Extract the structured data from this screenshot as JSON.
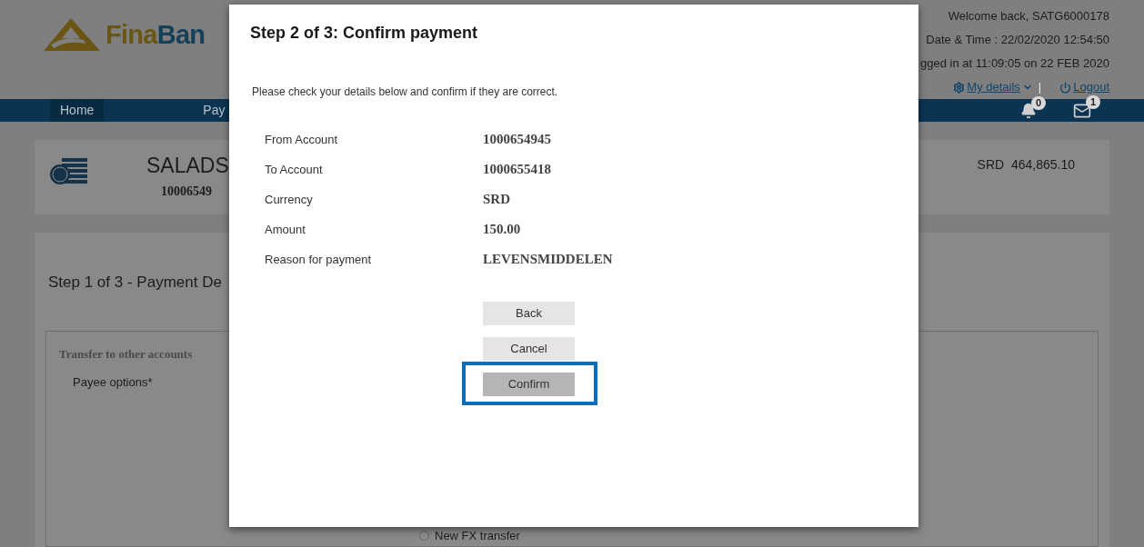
{
  "header": {
    "logo_first": "Fina",
    "logo_second": "Ban",
    "welcome": "Welcome back, SATG6000178",
    "datetime": "Date & Time : 22/02/2020 12:54:50",
    "last_login": "gged in at 11:09:05 on 22 FEB 2020",
    "my_details": "My details",
    "separator": "|",
    "logout": "Logout"
  },
  "nav": {
    "items": [
      {
        "label": "Home",
        "selected": true
      },
      {
        "label": "Pay",
        "selected": false
      }
    ],
    "notifications": "0",
    "messages": "1"
  },
  "account": {
    "name": "SALADS",
    "number": "10006549",
    "balance": "SRD  464,865.10"
  },
  "form": {
    "title": "Step 1 of 3 - Payment De",
    "section": "Transfer to other accounts",
    "payee_label": "Payee options*",
    "radio": {
      "label": "New FX transfer",
      "selected": false
    }
  },
  "modal": {
    "title": "Step 2 of 3: Confirm payment",
    "intro": "Please check your details below and confirm if they are correct.",
    "rows": [
      {
        "label": "From Account",
        "value": "1000654945"
      },
      {
        "label": "To Account",
        "value": "1000655418"
      },
      {
        "label": "Currency",
        "value": "SRD"
      },
      {
        "label": "Amount",
        "value": "150.00"
      },
      {
        "label": "Reason for payment",
        "value": "LEVENSMIDDELEN"
      }
    ],
    "buttons": [
      {
        "label": "Back",
        "highlighted": false
      },
      {
        "label": "Cancel",
        "highlighted": false
      },
      {
        "label": "Confirm",
        "highlighted": true
      }
    ]
  }
}
